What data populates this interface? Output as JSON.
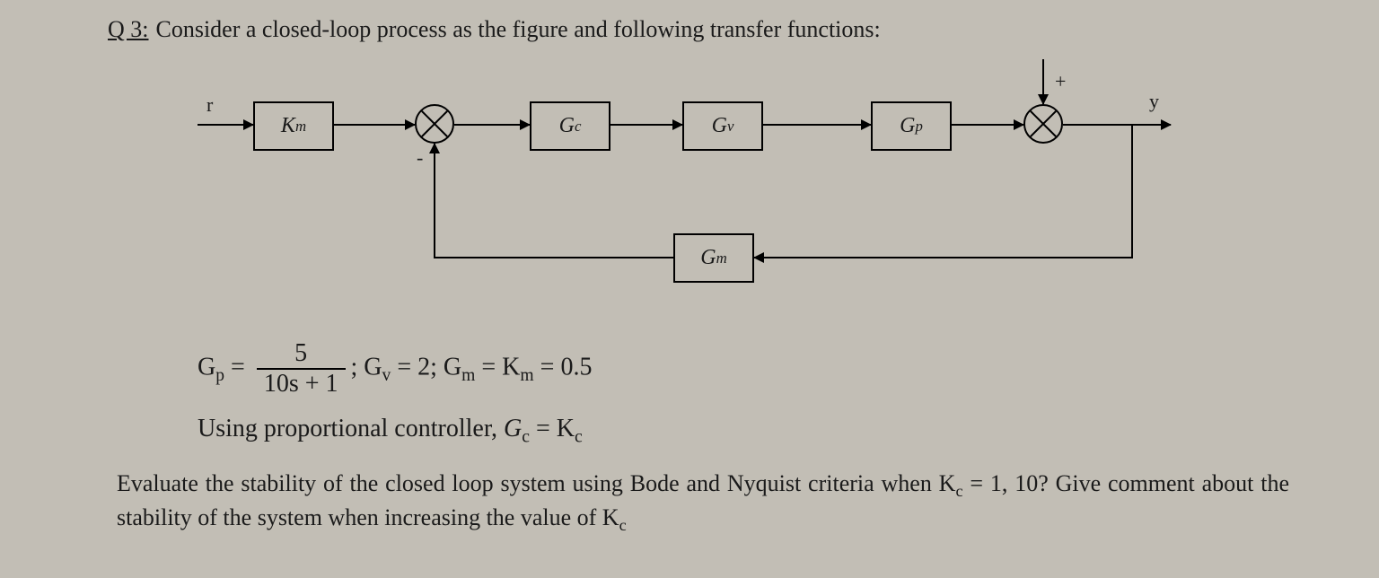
{
  "question": {
    "label": "Q 3:",
    "prompt": "Consider a closed-loop process as the figure and following transfer functions:"
  },
  "diagram": {
    "input_signal": "r",
    "output_signal": "y",
    "blocks": {
      "km": "K",
      "km_sub": "m",
      "gc": "G",
      "gc_sub": "c",
      "gv": "G",
      "gv_sub": "v",
      "gp": "G",
      "gp_sub": "p",
      "gm": "G",
      "gm_sub": "m"
    },
    "signs": {
      "sum2_top": "+",
      "sum1_bottom": "-"
    }
  },
  "equations": {
    "gp_lhs_sym": "G",
    "gp_lhs_sub": "p",
    "eq": "=",
    "gp_num": "5",
    "gp_den": "10s + 1",
    "sep1": ";",
    "gv_sym": "G",
    "gv_sub": "v",
    "gv_val": "= 2;",
    "gm_sym": "G",
    "gm_sub": "m",
    "km_sym": "= K",
    "km_sub": "m",
    "km_val": "= 0.5"
  },
  "controller_line": {
    "text1": "Using proportional controller, ",
    "gc_sym": "G",
    "gc_sub": "c",
    "eq": " = K",
    "kc_sub": "c"
  },
  "final_question": {
    "text1": "Evaluate the stability of the closed loop system using Bode and Nyquist criteria when K",
    "sub1": "c",
    "text2": " = 1, 10? Give comment about the stability of the system when increasing the value of K",
    "sub2": "c"
  }
}
